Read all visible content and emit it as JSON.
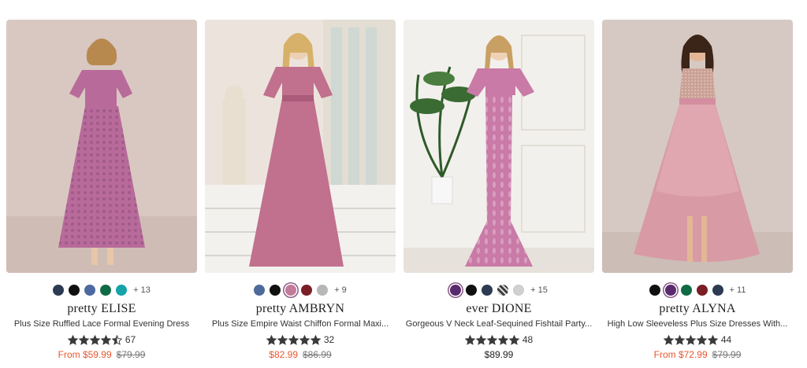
{
  "products": [
    {
      "brand": "pretty ELISE",
      "title": "Plus Size Ruffled Lace Formal Evening Dress",
      "rating": 4.5,
      "reviews": "67",
      "price": "From $59.99",
      "original_price": "$79.99",
      "more_colors": "+ 13",
      "swatches": [
        "#2c3a52",
        "#101010",
        "#4d6aa0",
        "#0f6b45",
        "#14a3a8"
      ],
      "selected_swatch": -1,
      "dress_color": "#b86b9b",
      "background": "#d9c8c1"
    },
    {
      "brand": "pretty AMBRYN",
      "title": "Plus Size Empire Waist Chiffon Formal Maxi...",
      "rating": 5,
      "reviews": "32",
      "price": "$82.99",
      "original_price": "$86.99",
      "more_colors": "+ 9",
      "swatches": [
        "#4f6a9a",
        "#101010",
        "#c27a98",
        "#7a1f25",
        "#b7b7b7"
      ],
      "selected_swatch": 2,
      "dress_color": "#c1708e",
      "background": "#ece4dc"
    },
    {
      "brand": "ever DIONE",
      "title": "Gorgeous V Neck Leaf-Sequined Fishtail Party...",
      "rating": 5,
      "reviews": "48",
      "price": "$89.99",
      "original_price": "",
      "more_colors": "+ 15",
      "swatches": [
        "#5a2a6e",
        "#101010",
        "#2c3a52",
        "#4a4a4a",
        "#d0d0d0"
      ],
      "selected_swatch": 0,
      "dress_color": "#c97aa6",
      "background": "#f2f0ec"
    },
    {
      "brand": "pretty ALYNA",
      "title": "High Low Sleeveless Plus Size Dresses With...",
      "rating": 5,
      "reviews": "44",
      "price": "From $72.99",
      "original_price": "$79.99",
      "more_colors": "+ 11",
      "swatches": [
        "#101010",
        "#5a2a6e",
        "#0f6b45",
        "#7a1f25",
        "#2c3a52"
      ],
      "selected_swatch": 1,
      "dress_color": "#d89aa5",
      "background": "#d6c9c3"
    }
  ],
  "colors": {
    "sale_price": "#e8562e",
    "star": "#3a3a3a",
    "selected_ring": "#8a5a86"
  }
}
